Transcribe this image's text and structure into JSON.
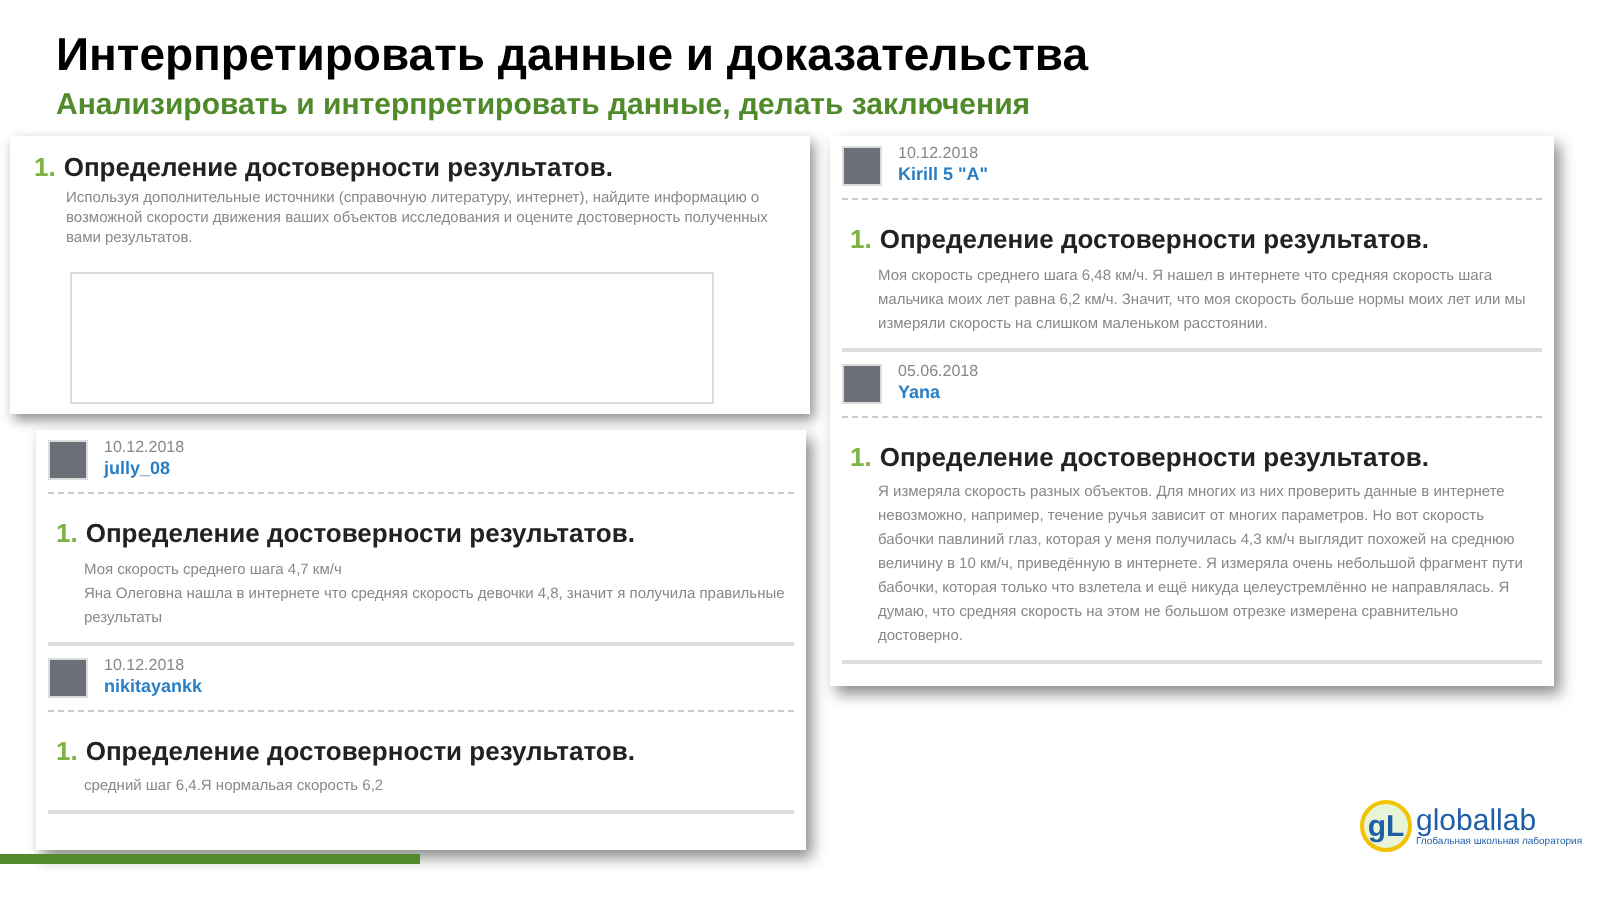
{
  "title": "Интерпретировать данные и доказательства",
  "subtitle": "Анализировать и интерпретировать данные, делать заключения",
  "task_panel": {
    "number": "1.",
    "heading": "Определение достоверности результатов.",
    "description": "Используя дополнительные источники (справочную литературу, интернет), найдите информацию о возможной скорости движения ваших объектов исследования и оцените достоверность полученных вами результатов."
  },
  "answer_panels": [
    {
      "entries": [
        {
          "date": "10.12.2018",
          "author": "Kirill 5 \"A\"",
          "number": "1.",
          "heading": "Определение достоверности результатов.",
          "answer": "Моя скорость среднего шага 6,48 км/ч. Я нашел в интернете что средняя скорость шага мальчика моих лет равна 6,2 км/ч. Значит, что моя скорость больше нормы моих лет или мы измеряли скорость на слишком маленьком расстоянии."
        },
        {
          "date": "05.06.2018",
          "author": "Yana",
          "number": "1.",
          "heading": "Определение достоверности результатов.",
          "answer": "Я измеряла скорость разных объектов. Для многих из них проверить данные в интернете невозможно, например, течение ручья зависит от многих параметров. Но вот скорость бабочки павлиний глаз, которая у меня получилась 4,3 км/ч выглядит похожей на среднюю величину в 10 км/ч, приведённую в интернете. Я измеряла очень небольшой фрагмент пути бабочки, которая только что взлетела и ещё никуда целеустремлённо не направлялась. Я думаю, что средняя скорость на этом не большом отрезке измерена сравнительно достоверно."
        }
      ]
    },
    {
      "entries": [
        {
          "date": "10.12.2018",
          "author": "jully_08",
          "number": "1.",
          "heading": "Определение достоверности результатов.",
          "answer": "Моя скорость среднего шага 4,7 км/ч\nЯна Олеговна нашла в интернете что средняя скорость девочки 4,8, значит я получила правильные результаты"
        },
        {
          "date": "10.12.2018",
          "author": "nikitayankk",
          "number": "1.",
          "heading": "Определение достоверности результатов.",
          "answer": "средний шаг 6,4.Я нормальая скорость 6,2"
        }
      ]
    }
  ],
  "logo": {
    "mark": "gL",
    "name": "globallab",
    "tagline": "Глобальная школьная лаборатория"
  }
}
